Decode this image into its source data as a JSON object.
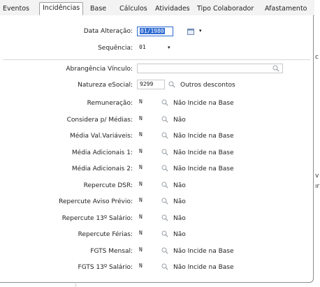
{
  "tabs": [
    "Eventos",
    "Incidências",
    "Base",
    "Cálculos",
    "Atividades",
    "Tipo Colaborador",
    "Afastamento"
  ],
  "active_tab": "Incidências",
  "header_fields": {
    "data_alteracao": {
      "label": "Data Alteração:",
      "value": "01/1980"
    },
    "sequencia": {
      "label": "Sequência:",
      "value": "01"
    }
  },
  "abrangencia": {
    "label": "Abrangência Vínculo:",
    "value": ""
  },
  "natureza": {
    "label": "Natureza eSocial:",
    "code": "9299",
    "desc": "Outros descontos"
  },
  "rows": [
    {
      "label": "Remuneração:",
      "code": "N",
      "desc": "Não Incide na Base"
    },
    {
      "label": "Considera p/ Médias:",
      "code": "N",
      "desc": "Não"
    },
    {
      "label": "Média Val.Variáveis:",
      "code": "N",
      "desc": "Não Incide na Base"
    },
    {
      "label": "Média Adicionais 1:",
      "code": "N",
      "desc": "Não Incide na Base"
    },
    {
      "label": "Média Adicionais 2:",
      "code": "N",
      "desc": "Não Incide na Base"
    },
    {
      "label": "Repercute DSR:",
      "code": "N",
      "desc": "Não"
    },
    {
      "label": "Repercute Aviso Prévio:",
      "code": "N",
      "desc": "Não"
    },
    {
      "label": "Repercute 13º Salário:",
      "code": "N",
      "desc": "Não"
    },
    {
      "label": "Repercute Férias:",
      "code": "N",
      "desc": "Não"
    },
    {
      "label": "FGTS Mensal:",
      "code": "N",
      "desc": "Não Incide na Base"
    },
    {
      "label": "FGTS 13º Salário:",
      "code": "N",
      "desc": "Não Incide na Base"
    }
  ],
  "outside_text": [
    "c",
    "v",
    "ır"
  ],
  "colors": {
    "selection": "#2d6ad1",
    "border": "#8d8d8d"
  }
}
